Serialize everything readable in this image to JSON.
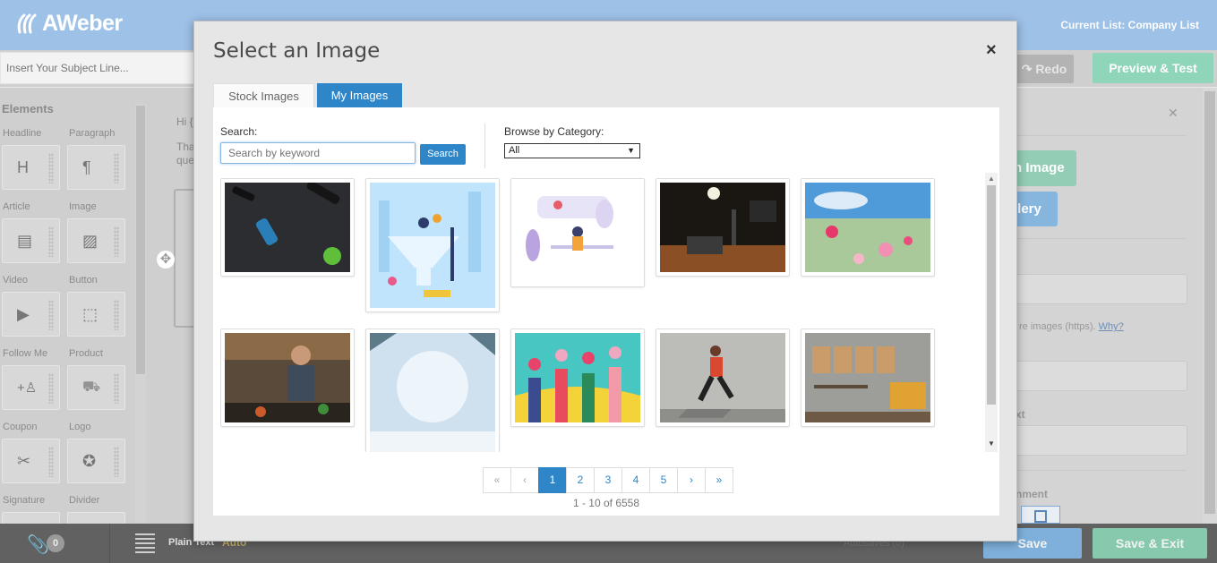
{
  "app": {
    "brand": "AWeber",
    "current_list_label": "Current List:",
    "current_list_value": "Company List"
  },
  "toolbar": {
    "subject_placeholder": "Insert Your Subject Line...",
    "redo_label": "Redo",
    "preview_label": "Preview & Test"
  },
  "elements_panel": {
    "title": "Elements",
    "items": [
      {
        "label": "Headline",
        "icon": "headline-icon",
        "glyph": "H"
      },
      {
        "label": "Paragraph",
        "icon": "paragraph-icon",
        "glyph": "¶"
      },
      {
        "label": "Article",
        "icon": "article-icon",
        "glyph": "▤"
      },
      {
        "label": "Image",
        "icon": "image-icon",
        "glyph": "▨"
      },
      {
        "label": "Video",
        "icon": "video-icon",
        "glyph": "▶"
      },
      {
        "label": "Button",
        "icon": "button-cursor-icon",
        "glyph": "⬚"
      },
      {
        "label": "Follow Me",
        "icon": "follow-me-icon",
        "glyph": "+♙"
      },
      {
        "label": "Product",
        "icon": "cart-icon",
        "glyph": "🛒"
      },
      {
        "label": "Coupon",
        "icon": "scissors-icon",
        "glyph": "✂"
      },
      {
        "label": "Logo",
        "icon": "logo-star-icon",
        "glyph": "✪"
      },
      {
        "label": "Signature",
        "icon": "signature-icon",
        "glyph": ""
      },
      {
        "label": "Divider",
        "icon": "divider-icon",
        "glyph": ""
      }
    ]
  },
  "canvas": {
    "greeting": "Hi {",
    "line1": "Tha",
    "line2": "que"
  },
  "right_panel": {
    "btn_upload": "n Image",
    "btn_gallery": "llery",
    "https_note": "re images (https).",
    "https_link": "Why?",
    "label_alt": "xt",
    "label_alignment": "nment"
  },
  "bottom_bar": {
    "attachment_count": "0",
    "plain_text_label": "Plain Text",
    "plain_text_mode": "Auto",
    "autosave_text": "Autosaves (0)",
    "save_label": "Save",
    "save_exit_label": "Save & Exit"
  },
  "modal": {
    "title": "Select an Image",
    "close": "×",
    "tabs": [
      {
        "label": "Stock Images",
        "active": false
      },
      {
        "label": "My Images",
        "active": true
      }
    ],
    "search_label": "Search:",
    "search_placeholder": "Search by keyword",
    "search_button": "Search",
    "category_label": "Browse by Category:",
    "category_value": "All",
    "images": [
      "fitness-gear-photo",
      "funnel-illustration",
      "office-illustration",
      "podcast-studio-photo",
      "flower-meadow-photo",
      "chef-cooking-photo",
      "snowy-winter-photo",
      "hands-with-hearts-illustration",
      "runner-woman-photo",
      "blog-letters-photo"
    ],
    "pagination": {
      "first": "«",
      "prev": "‹",
      "pages": [
        "1",
        "2",
        "3",
        "4",
        "5"
      ],
      "current": "1",
      "next": "›",
      "last": "»",
      "info": "1 - 10 of 6558"
    }
  },
  "colors": {
    "brand_bar": "#9ec1e8",
    "primary": "#2e86c9",
    "green_button": "#8fd5b9"
  }
}
